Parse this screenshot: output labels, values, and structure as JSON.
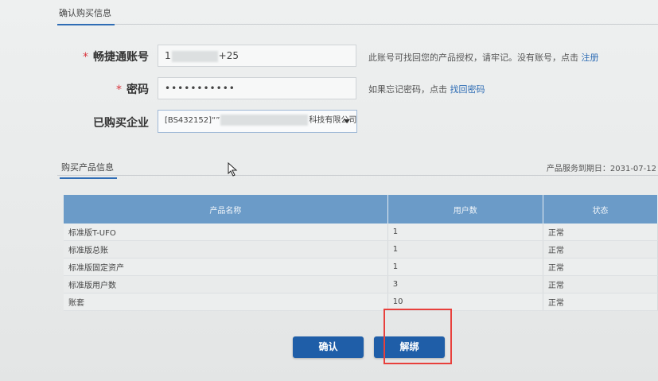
{
  "section_title": "确认购买信息",
  "form": {
    "account": {
      "required_mark": "*",
      "label": "畅捷通账号",
      "value_prefix": "1",
      "value_suffix": "+25",
      "hint_text": "此账号可找回您的产品授权，请牢记。没有账号，点击",
      "hint_link": "注册"
    },
    "password": {
      "required_mark": "*",
      "label": "密码",
      "value": "•••••••••••",
      "hint_text": "如果忘记密码，点击",
      "hint_link": "找回密码"
    },
    "company": {
      "label": "已购买企业",
      "value_prefix": "[BS432152]“”",
      "value_suffix": "科技有限公司"
    }
  },
  "products": {
    "section_title": "购买产品信息",
    "service_date": "产品服务到期日：2031-07-12",
    "columns": [
      "产品名称",
      "用户数",
      "状态"
    ],
    "rows": [
      [
        "标准版T-UFO",
        "1",
        "正常"
      ],
      [
        "标准版总账",
        "1",
        "正常"
      ],
      [
        "标准版固定资产",
        "1",
        "正常"
      ],
      [
        "标准版用户数",
        "3",
        "正常"
      ],
      [
        "账套",
        "10",
        "正常"
      ]
    ]
  },
  "buttons": {
    "confirm": "确认",
    "unbind": "解绑"
  },
  "colors": {
    "accent": "#1f5ea8",
    "table_header": "#6b9bc8",
    "highlight": "#e8403c"
  }
}
